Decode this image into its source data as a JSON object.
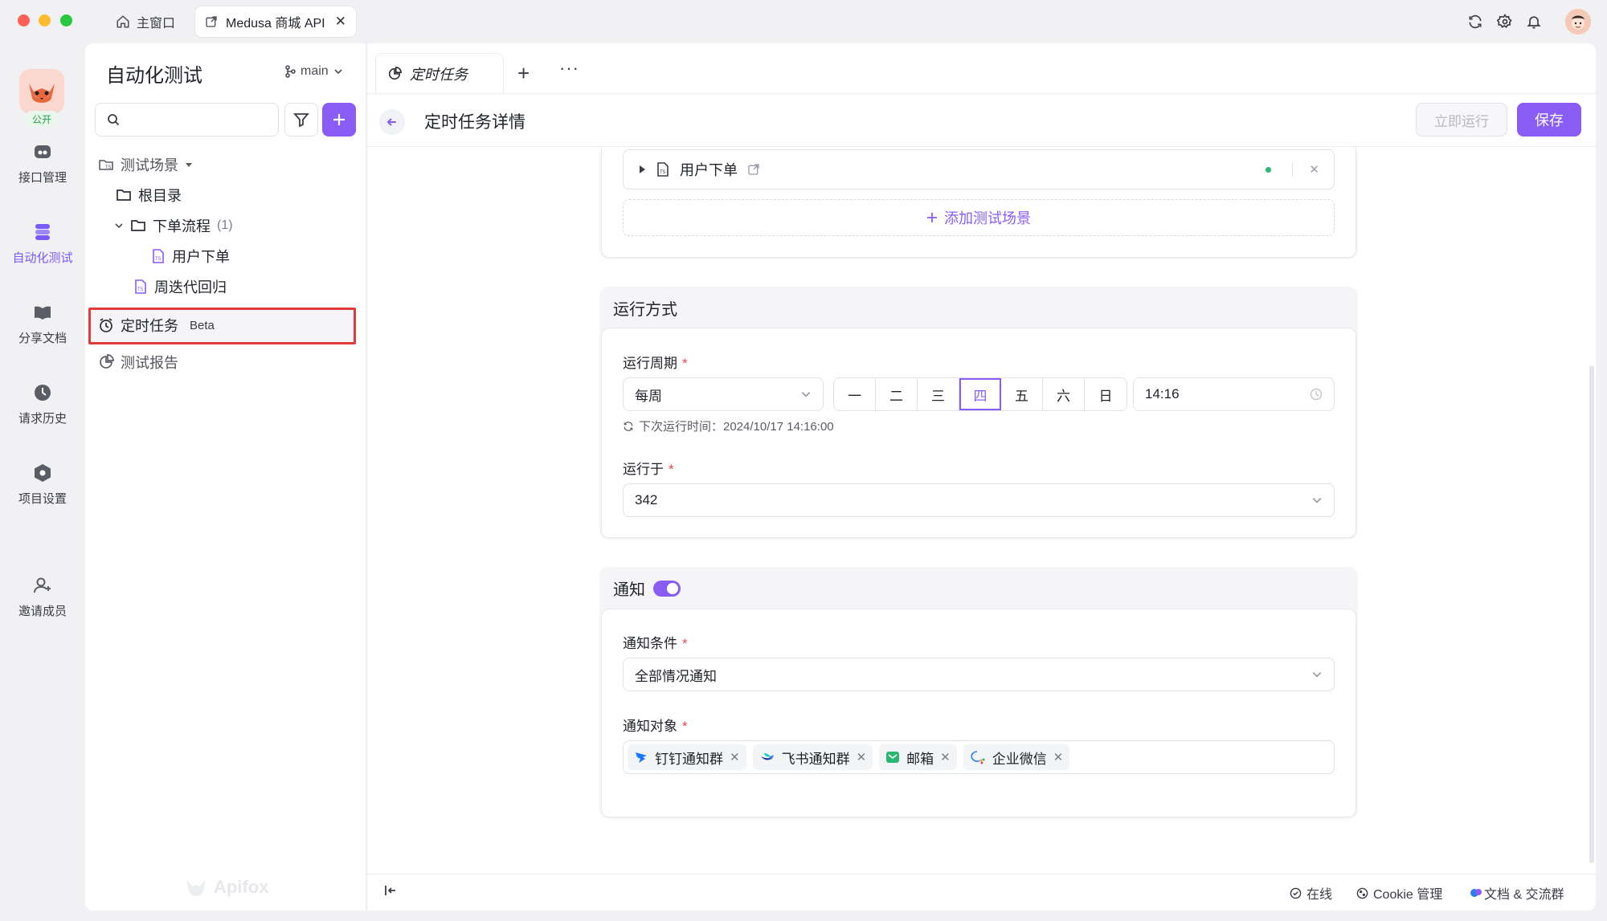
{
  "window": {
    "home_tab": "主窗口",
    "doc_tab": "Medusa 商城 API"
  },
  "rail": {
    "badge": "公开",
    "items": [
      {
        "label": "接口管理",
        "icon": "api-icon"
      },
      {
        "label": "自动化测试",
        "icon": "automation-icon",
        "active": true
      },
      {
        "label": "分享文档",
        "icon": "book-icon"
      },
      {
        "label": "请求历史",
        "icon": "clock-icon"
      },
      {
        "label": "项目设置",
        "icon": "settings-hex-icon"
      },
      {
        "label": "邀请成员",
        "icon": "add-user-icon"
      }
    ]
  },
  "sidebar": {
    "title": "自动化测试",
    "branch": "main",
    "search_placeholder": "",
    "tree": {
      "scenarios_label": "测试场景",
      "root_label": "根目录",
      "folder_label": "下单流程",
      "folder_count": "(1)",
      "case_order": "用户下单",
      "case_regression": "周迭代回归"
    },
    "scheduled_label": "定时任务",
    "scheduled_badge": "Beta",
    "reports_label": "测试报告",
    "watermark": "Apifox"
  },
  "main": {
    "tab_label": "定时任务",
    "page_title": "定时任务详情",
    "run_now": "立即运行",
    "save": "保存",
    "scenario_row": "用户下单",
    "add_scenario": "添加测试场景",
    "run_mode": {
      "title": "运行方式",
      "cycle_label": "运行周期",
      "cycle_value": "每周",
      "days": [
        "一",
        "二",
        "三",
        "四",
        "五",
        "六",
        "日"
      ],
      "selected_day": "四",
      "time_value": "14:16",
      "next_run": "下次运行时间：2024/10/17 14:16:00",
      "run_on_label": "运行于",
      "run_on_value": "342"
    },
    "notify": {
      "title": "通知",
      "enabled": true,
      "condition_label": "通知条件",
      "condition_value": "全部情况通知",
      "target_label": "通知对象",
      "targets": [
        "钉钉通知群",
        "飞书通知群",
        "邮箱",
        "企业微信"
      ]
    }
  },
  "footer": {
    "online": "在线",
    "cookie": "Cookie 管理",
    "docs": "文档 & 交流群"
  },
  "colors": {
    "accent": "#8a5cf6",
    "required": "#e5484d",
    "highlight_border": "#e03a3a",
    "public_badge": "#27a146"
  }
}
